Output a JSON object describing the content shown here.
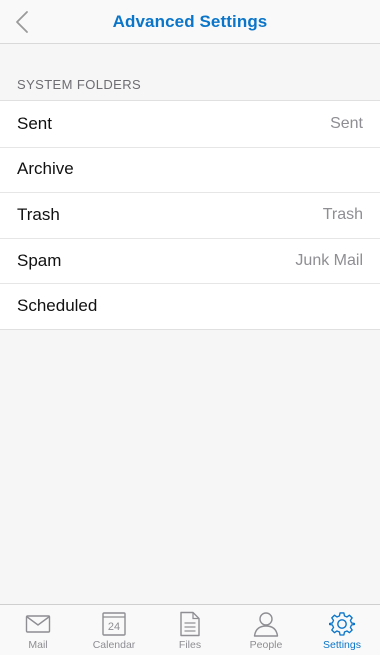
{
  "header": {
    "title": "Advanced Settings",
    "back_icon": "chevron-left-icon"
  },
  "section": {
    "title": "SYSTEM FOLDERS",
    "rows": [
      {
        "label": "Sent",
        "value": "Sent"
      },
      {
        "label": "Archive",
        "value": ""
      },
      {
        "label": "Trash",
        "value": "Trash"
      },
      {
        "label": "Spam",
        "value": "Junk Mail"
      },
      {
        "label": "Scheduled",
        "value": ""
      }
    ]
  },
  "tabbar": {
    "tabs": [
      {
        "label": "Mail",
        "icon": "mail-icon"
      },
      {
        "label": "Calendar",
        "icon": "calendar-icon",
        "badge": "24"
      },
      {
        "label": "Files",
        "icon": "files-icon"
      },
      {
        "label": "People",
        "icon": "people-icon"
      },
      {
        "label": "Settings",
        "icon": "settings-icon",
        "active": true
      }
    ]
  },
  "colors": {
    "accent": "#0a75c9",
    "inactive": "#8e8e93",
    "background": "#f6f6f6"
  }
}
